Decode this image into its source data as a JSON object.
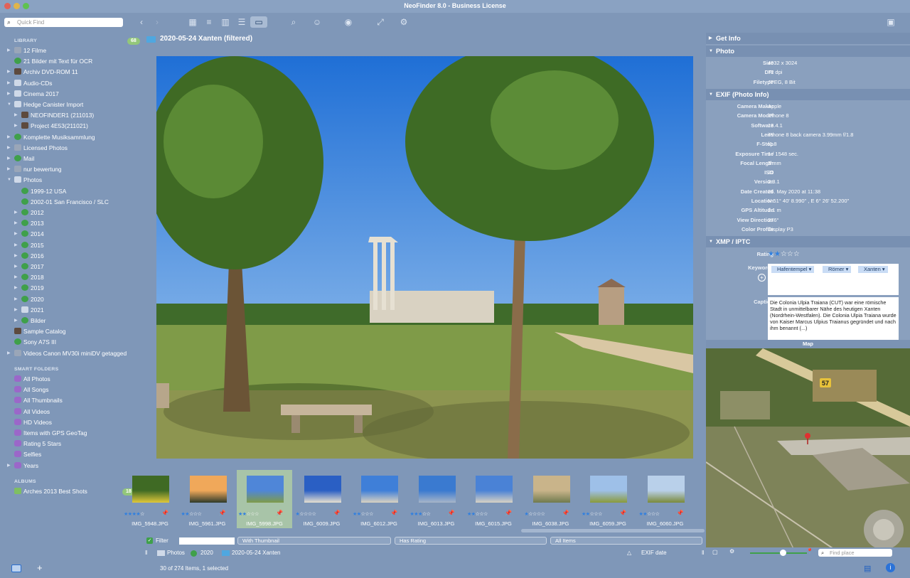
{
  "window": {
    "title": "NeoFinder 8.0 - Business License"
  },
  "search": {
    "placeholder": "Quick Find"
  },
  "sidebar": {
    "library_header": "LIBRARY",
    "library_count": "68",
    "items": [
      "12 Filme",
      "21 Bilder mit Text für OCR",
      "Archiv DVD-ROM 11",
      "Audio-CDs",
      "Cinema 2017",
      "Hedge Canister Import",
      "NEOFINDER1 (211013)",
      "Project 4E53(211021)",
      "Komplette Musiksammlung",
      "Licensed Photos",
      "Mail",
      "nur bewertung",
      "Photos",
      "1999-12 USA",
      "2002-01 San Francisco / SLC",
      "2012",
      "2013",
      "2014",
      "2015",
      "2016",
      "2017",
      "2018",
      "2019",
      "2020",
      "2021",
      "Bilder",
      "Sample Catalog",
      "Sony A7S III",
      "Videos Canon MV30i miniDV getagged"
    ],
    "smart_header": "SMART FOLDERS",
    "smart_items": [
      "All Photos",
      "All Songs",
      "All Thumbnails",
      "All Videos",
      "HD Videos",
      "Items with GPS GeoTag",
      "Rating 5 Stars",
      "Selfies",
      "Years"
    ],
    "albums_header": "ALBUMS",
    "albums": [
      "Arches 2013 Best Shots"
    ],
    "albums_count": "18"
  },
  "content": {
    "title": "2020-05-24 Xanten  (filtered)"
  },
  "thumbnails": [
    {
      "name": "IMG_5948.JPG",
      "rating": 4
    },
    {
      "name": "IMG_5961.JPG",
      "rating": 2
    },
    {
      "name": "IMG_5998.JPG",
      "rating": 2,
      "selected": true
    },
    {
      "name": "IMG_6009.JPG",
      "rating": 1
    },
    {
      "name": "IMG_6012.JPG",
      "rating": 2
    },
    {
      "name": "IMG_6013.JPG",
      "rating": 3
    },
    {
      "name": "IMG_6015.JPG",
      "rating": 2
    },
    {
      "name": "IMG_6038.JPG",
      "rating": 1
    },
    {
      "name": "IMG_6059.JPG",
      "rating": 2
    },
    {
      "name": "IMG_6060.JPG",
      "rating": 2
    }
  ],
  "filter": {
    "label": "Filter",
    "thumb": "With Thumbnail",
    "rating": "Has Rating",
    "items": "All Items"
  },
  "path": {
    "p1": "Photos",
    "p2": "2020",
    "p3": "2020-05-24 Xanten",
    "sort": "EXIF date"
  },
  "status": {
    "text": "30 of 274  Items, 1 selected",
    "find_placeholder": "Find place"
  },
  "info": {
    "get_info": "Get Info",
    "photo": "Photo",
    "photo_kv": [
      [
        "Size",
        "4032 x 3024"
      ],
      [
        "DPI",
        "72 dpi"
      ],
      [
        "Filetype",
        "JPEG, 8 Bit"
      ]
    ],
    "exif": "EXIF (Photo Info)",
    "exif_kv": [
      [
        "Camera Maker",
        "Apple"
      ],
      [
        "Camera Model",
        "iPhone 8"
      ],
      [
        "Software",
        "13.4.1"
      ],
      [
        "Lens",
        "iPhone 8 back camera 3.99mm f/1.8"
      ],
      [
        "F-Stop",
        "f1.8"
      ],
      [
        "Exposure Time",
        "1 / 1548 sec."
      ],
      [
        "Focal Length",
        "3 mm"
      ],
      [
        "ISO",
        "20"
      ],
      [
        "Version",
        "2.3.1"
      ],
      [
        "Date Created",
        "26. May 2020 at 11:38"
      ],
      [
        "Location",
        "N 51° 40' 8.990\" , E 6° 26' 52.200\""
      ],
      [
        "GPS Altitude",
        "2.1 m"
      ],
      [
        "View Direction",
        "276°"
      ],
      [
        "Color Profile",
        "Display P3"
      ]
    ],
    "xmp": "XMP / IPTC",
    "rating_label": "Rating",
    "rating": 2,
    "keywords_label": "Keywords",
    "keywords": [
      "Hafentempel",
      "Römer",
      "Xanten"
    ],
    "caption_label": "Caption",
    "caption": "Die Colonia Ulpia Traiana (CUT) war eine römische Stadt in unmittelbarer Nähe des heutigen Xanten (Nordrhein-Westfalen). Die Colonia Ulpia Traiana wurde von Kaiser Marcus Ulpius Traianus gegründet und nach ihm benannt (...)"
  },
  "map": {
    "title": "Map",
    "road_shield": "57"
  }
}
